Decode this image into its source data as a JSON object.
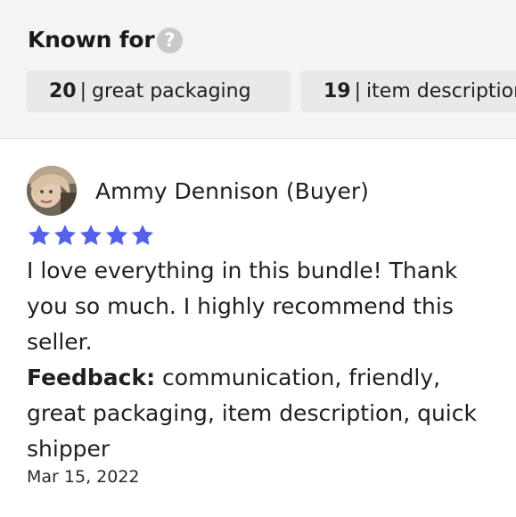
{
  "known_for": {
    "title": "Known for",
    "help_icon": "question-circle-icon",
    "tags": [
      {
        "count": "20",
        "label": "great packaging"
      },
      {
        "count": "19",
        "label": "item description"
      }
    ]
  },
  "review": {
    "reviewer": "Ammy Dennison (Buyer)",
    "rating": 5,
    "rating_max": 5,
    "star_color": "#5561e8",
    "text": " I love everything in this bundle! Thank you so much. I highly recommend this seller.",
    "feedback_label": "Feedback:",
    "feedback_value": " communication, friendly, great packaging, item description, quick shipper",
    "date": "Mar 15, 2022"
  }
}
